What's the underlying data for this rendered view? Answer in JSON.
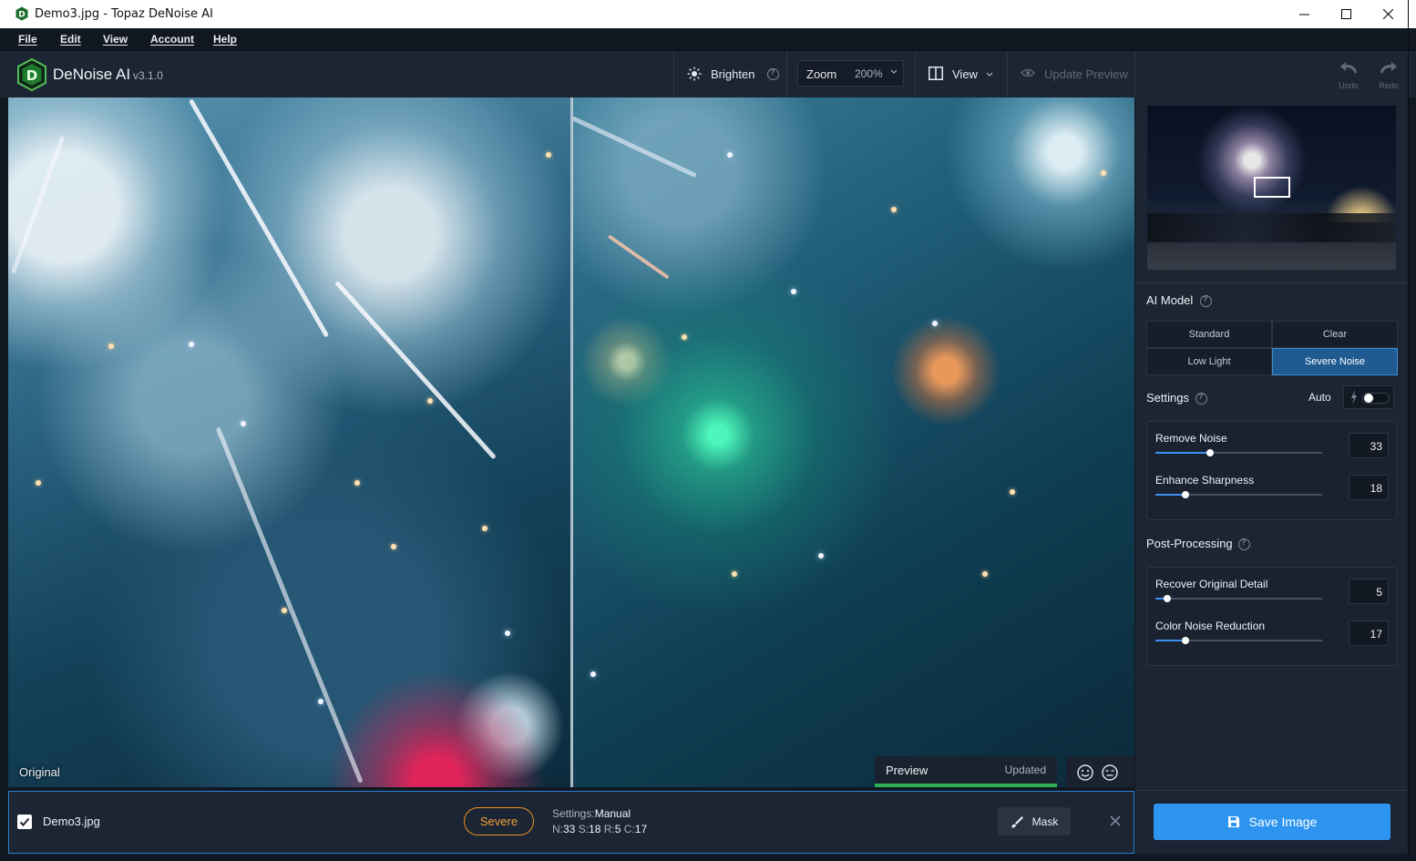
{
  "window": {
    "title": "Demo3.jpg - Topaz DeNoise AI"
  },
  "menu": [
    "File",
    "Edit",
    "View",
    "Account",
    "Help"
  ],
  "toolbar": {
    "brand": "DeNoise AI",
    "version": "v3.1.0",
    "brighten": "Brighten",
    "zoom_label": "Zoom",
    "zoom_value": "200%",
    "view": "View",
    "update_preview": "Update Preview",
    "undo": "Undo",
    "redo": "Redo"
  },
  "viewer": {
    "original_label": "Original",
    "preview_label": "Preview",
    "preview_status": "Updated"
  },
  "panel": {
    "ai_model_title": "AI Model",
    "models": [
      "Standard",
      "Clear",
      "Low Light",
      "Severe Noise"
    ],
    "selected_model": "Severe Noise",
    "settings_title": "Settings",
    "auto_label": "Auto",
    "auto_enabled": false,
    "sliders": [
      {
        "label": "Remove Noise",
        "value": "33",
        "fraction": 0.33
      },
      {
        "label": "Enhance Sharpness",
        "value": "18",
        "fraction": 0.18
      }
    ],
    "post_title": "Post-Processing",
    "post_sliders": [
      {
        "label": "Recover Original Detail",
        "value": "5",
        "fraction": 0.07
      },
      {
        "label": "Color Noise Reduction",
        "value": "17",
        "fraction": 0.18
      }
    ],
    "save_label": "Save Image"
  },
  "filebar": {
    "filename": "Demo3.jpg",
    "checked": true,
    "model_badge": "Severe",
    "settings_label": "Settings:",
    "settings_mode": "Manual",
    "n_label": "N:",
    "n_value": "33",
    "s_label": "S:",
    "s_value": "18",
    "r_label": "R:",
    "r_value": "5",
    "c_label": "C:",
    "c_value": "17",
    "mask_label": "Mask"
  },
  "colors": {
    "accent": "#2d95ef",
    "active_model": "#1f5a90",
    "severe_badge": "#e8921e",
    "preview_bar": "#2fae5a",
    "panel_bg": "#1c2533"
  }
}
